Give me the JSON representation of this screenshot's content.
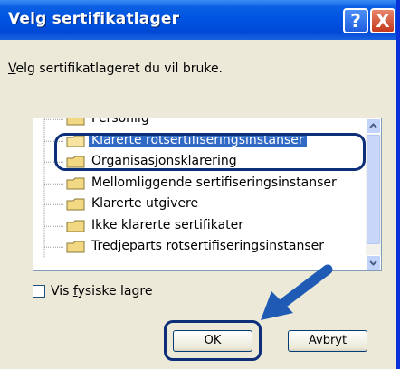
{
  "window": {
    "title": "Velg sertifikatlager",
    "help_glyph": "?",
    "close_glyph": "X"
  },
  "prompt": {
    "accel": "V",
    "rest": "elg sertifikatlageret du vil bruke."
  },
  "tree": {
    "items": [
      {
        "label": "Personlig",
        "selected": false
      },
      {
        "label": "Klarerte rotsertifiseringsinstanser",
        "selected": true
      },
      {
        "label": "Organisasjonsklarering",
        "selected": false
      },
      {
        "label": "Mellomliggende sertifiseringsinstanser",
        "selected": false
      },
      {
        "label": "Klarerte utgivere",
        "selected": false
      },
      {
        "label": "Ikke klarerte sertifikater",
        "selected": false
      },
      {
        "label": "Tredjeparts rotsertifiseringsinstanser",
        "selected": false
      }
    ]
  },
  "checkbox": {
    "label_before": "Vis ",
    "accel": "f",
    "label_after": "ysiske lagre",
    "checked": false
  },
  "buttons": {
    "ok": "OK",
    "cancel": "Avbryt"
  },
  "colors": {
    "title_bar": "#0054e3",
    "selection": "#316ac5",
    "highlight_annotation": "#0d2f7a",
    "pointer_arrow": "#1f5bb5"
  },
  "icons": {
    "folder": "folder-icon",
    "annotation_arrow": "pointer-arrow-icon"
  }
}
